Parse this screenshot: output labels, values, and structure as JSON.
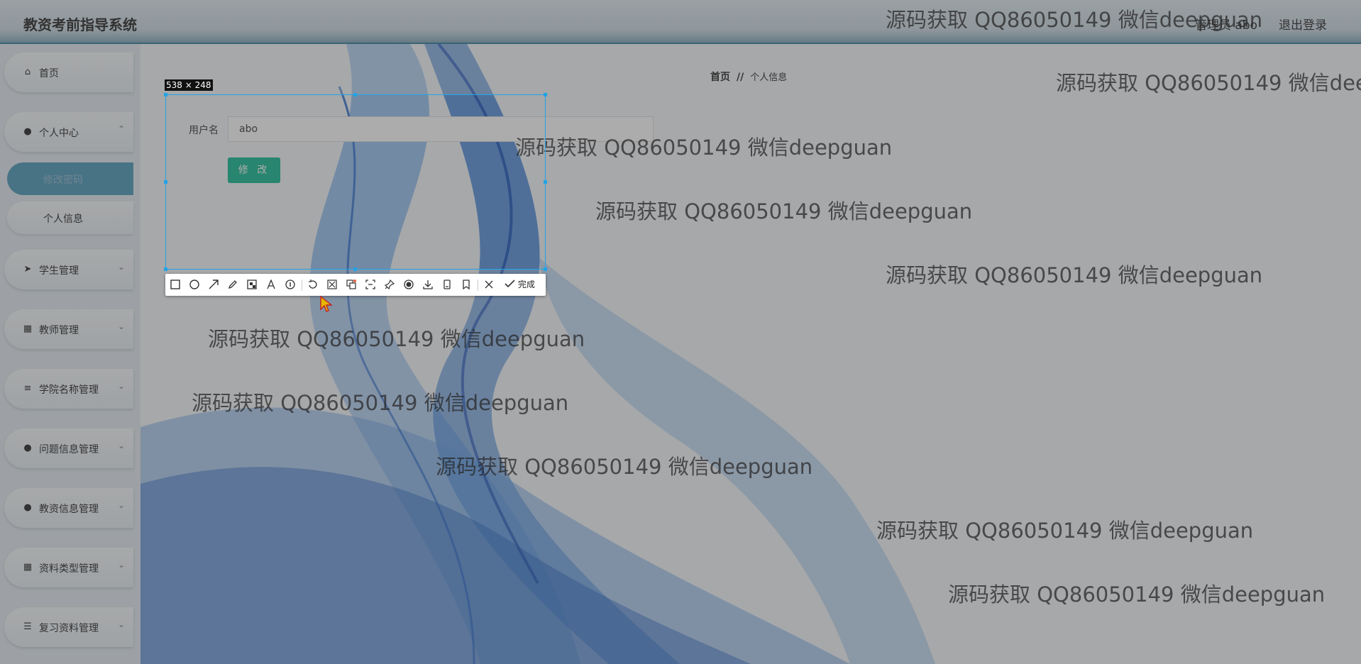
{
  "header": {
    "title": "教资考前指导系统",
    "admin_label": "管理员 abo",
    "logout": "退出登录"
  },
  "sidebar": {
    "items": [
      {
        "label": "首页",
        "icon": "home-icon"
      },
      {
        "label": "个人中心",
        "icon": "user-icon"
      },
      {
        "label": "学生管理",
        "icon": "paper-plane-icon"
      },
      {
        "label": "教师管理",
        "icon": "grid-icon"
      },
      {
        "label": "学院名称管理",
        "icon": "sliders-icon"
      },
      {
        "label": "问题信息管理",
        "icon": "user-icon"
      },
      {
        "label": "教资信息管理",
        "icon": "user-tie-icon"
      },
      {
        "label": "资料类型管理",
        "icon": "grid-icon"
      },
      {
        "label": "复习资料管理",
        "icon": "list-icon"
      }
    ],
    "sub_items": [
      {
        "label": "修改密码",
        "active": true
      },
      {
        "label": "个人信息",
        "active": false
      }
    ]
  },
  "breadcrumb": {
    "home": "首页",
    "separator": "//",
    "current": "个人信息"
  },
  "form": {
    "username_label": "用户名",
    "username_value": "abo",
    "submit_label": "修 改"
  },
  "capture": {
    "size_label": "538 × 248",
    "done_label": "完成",
    "tools": [
      "rectangle-icon",
      "ellipse-icon",
      "arrow-icon",
      "pencil-icon",
      "mosaic-icon",
      "text-icon",
      "number-marker-icon",
      "undo-icon",
      "scissors-icon",
      "translate-icon",
      "ocr-icon",
      "pin-icon",
      "record-icon",
      "download-icon",
      "phone-icon",
      "bookmark-icon",
      "close-icon",
      "check-icon"
    ]
  },
  "watermark_text": "源码获取 QQ86050149 微信deepguan",
  "colors": {
    "accent": "#10b890",
    "sidebar_active": "#4a97b9",
    "header_border": "#2f7a98",
    "selection": "#22a3e6"
  }
}
